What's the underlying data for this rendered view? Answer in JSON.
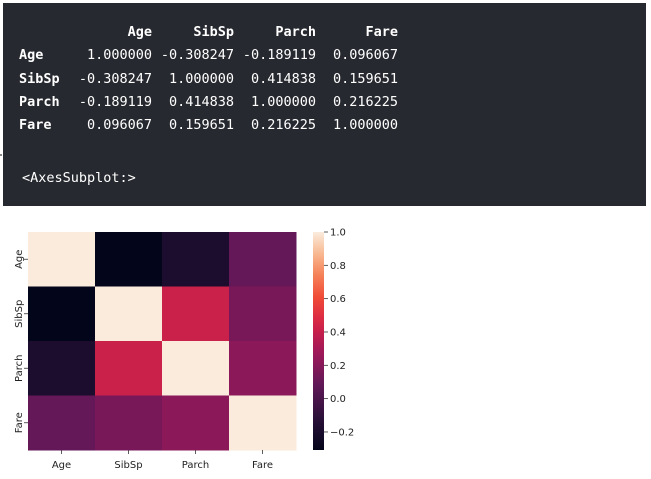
{
  "dataframe": {
    "columns": [
      "",
      "Age",
      "SibSp",
      "Parch",
      "Fare"
    ],
    "rows": [
      {
        "label": "Age",
        "values": [
          "1.000000",
          "-0.308247",
          "-0.189119",
          "0.096067"
        ]
      },
      {
        "label": "SibSp",
        "values": [
          "-0.308247",
          "1.000000",
          "0.414838",
          "0.159651"
        ]
      },
      {
        "label": "Parch",
        "values": [
          "-0.189119",
          "0.414838",
          "1.000000",
          "0.216225"
        ]
      },
      {
        "label": "Fare",
        "values": [
          "0.096067",
          "0.159651",
          "0.216225",
          "1.000000"
        ]
      }
    ]
  },
  "repr_text": "<AxesSubplot:>",
  "colors": {
    "cell_background": "#26292f",
    "text": "#ffffff"
  },
  "chart_data": {
    "type": "heatmap",
    "colormap": "rocket",
    "x_categories": [
      "Age",
      "SibSp",
      "Parch",
      "Fare"
    ],
    "y_categories": [
      "Age",
      "SibSp",
      "Parch",
      "Fare"
    ],
    "values": [
      [
        1.0,
        -0.308247,
        -0.189119,
        0.096067
      ],
      [
        -0.308247,
        1.0,
        0.414838,
        0.159651
      ],
      [
        -0.189119,
        0.414838,
        1.0,
        0.216225
      ],
      [
        0.096067,
        0.159651,
        0.216225,
        1.0
      ]
    ],
    "vmin": -0.308247,
    "vmax": 1.0,
    "colorbar_ticks": [
      1.0,
      0.8,
      0.6,
      0.4,
      0.2,
      0.0,
      -0.2
    ],
    "colorbar_tick_labels": [
      "1.0",
      "0.8",
      "0.6",
      "0.4",
      "0.2",
      "0.0",
      "−0.2"
    ],
    "colorbar_side": "right"
  }
}
